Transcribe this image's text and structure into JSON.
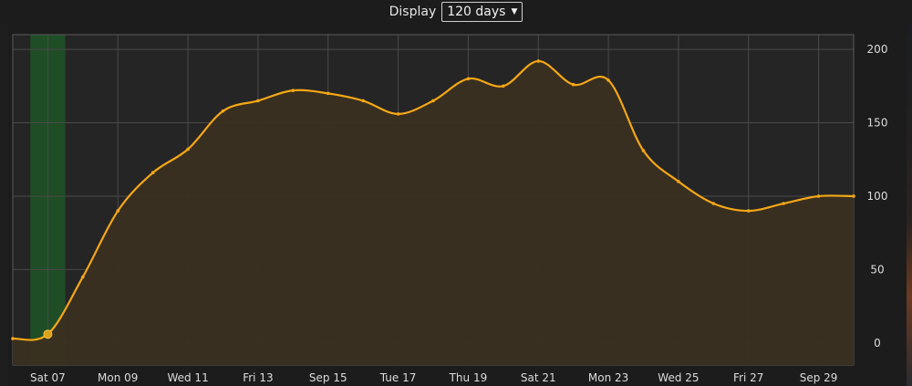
{
  "header": {
    "display_label": "Display",
    "range_select": {
      "selected": "120 days",
      "chevron_icon": "chevron-down-icon"
    }
  },
  "colors": {
    "line": "#f5a716",
    "area_fill": "#3a2f20",
    "plot_bg": "#252525",
    "grid": "#4a4a4a",
    "highlight": "#1f4d25"
  },
  "chart_data": {
    "type": "area",
    "title": "",
    "xlabel": "",
    "ylabel": "",
    "ylim": [
      -15,
      210
    ],
    "yticks": [
      0,
      50,
      100,
      150,
      200
    ],
    "x_ticks": [
      "Sat 07",
      "Mon 09",
      "Wed 11",
      "Fri 13",
      "Sep 15",
      "Tue 17",
      "Thu 19",
      "Sat 21",
      "Mon 23",
      "Wed 25",
      "Fri 27",
      "Sep 29"
    ],
    "x_tick_days": [
      7,
      9,
      11,
      13,
      15,
      17,
      19,
      21,
      23,
      25,
      27,
      29
    ],
    "x_range": [
      6,
      30
    ],
    "highlight_band": [
      6.5,
      7.5
    ],
    "highlighted_point": {
      "x": 7,
      "y": 6
    },
    "series": [
      {
        "x": [
          6,
          7,
          8,
          9,
          10,
          11,
          12,
          13,
          14,
          15,
          16,
          17,
          18,
          19,
          20,
          21,
          22,
          23,
          24,
          25,
          26,
          27,
          28,
          29,
          30
        ],
        "values": [
          3,
          6,
          45,
          90,
          116,
          132,
          158,
          165,
          172,
          170,
          165,
          156,
          165,
          180,
          175,
          192,
          176,
          179,
          131,
          110,
          95,
          90,
          95,
          100,
          100
        ]
      }
    ]
  }
}
